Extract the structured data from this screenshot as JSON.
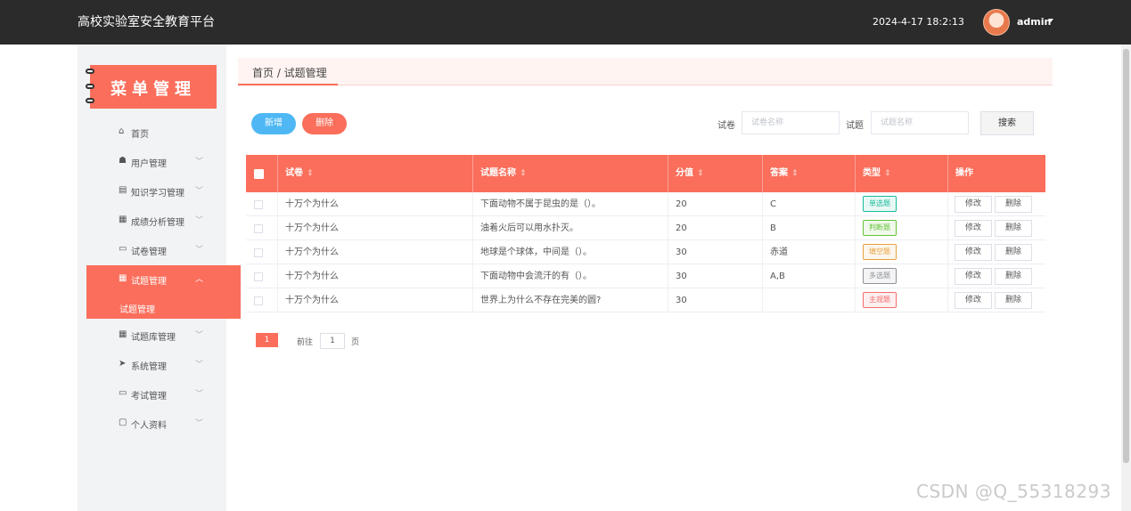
{
  "header": {
    "app_title": "高校实验室安全教育平台",
    "datetime": "2024-4-17 18:2:13",
    "username": "admin"
  },
  "sidebar": {
    "banner_title": "菜单管理",
    "items": [
      {
        "label": "首页",
        "icon": "home-icon"
      },
      {
        "label": "用户管理",
        "icon": "user-icon"
      },
      {
        "label": "知识学习管理",
        "icon": "book-icon"
      },
      {
        "label": "成绩分析管理",
        "icon": "grid-icon"
      },
      {
        "label": "试卷管理",
        "icon": "monitor-icon"
      },
      {
        "label": "试题管理",
        "icon": "grid-icon",
        "active": true
      },
      {
        "label": "试题库管理",
        "icon": "grid-icon"
      },
      {
        "label": "系统管理",
        "icon": "send-icon"
      },
      {
        "label": "考试管理",
        "icon": "monitor-icon"
      },
      {
        "label": "个人资料",
        "icon": "card-icon"
      }
    ],
    "active_sub_label": "试题管理"
  },
  "breadcrumb": "首页 / 试题管理",
  "toolbar": {
    "add_label": "新增",
    "delete_label": "删除",
    "paper_label": "试卷",
    "paper_placeholder": "试卷名称",
    "question_label": "试题",
    "question_placeholder": "试题名称",
    "search_label": "搜索"
  },
  "table": {
    "headers": [
      "试卷",
      "试题名称",
      "分值",
      "答案",
      "类型",
      "操作"
    ],
    "edit_label": "修改",
    "delete_label": "删除",
    "rows": [
      {
        "paper": "十万个为什么",
        "question": "下面动物不属于昆虫的是（）。",
        "score": "20",
        "answer": "C",
        "type": "单选题",
        "type_color": "#1abc9c",
        "type_bg": "#e8f8f4"
      },
      {
        "paper": "十万个为什么",
        "question": "油着火后可以用水扑灭。",
        "score": "20",
        "answer": "B",
        "type": "判断题",
        "type_color": "#67c23a",
        "type_bg": "#f0f9eb"
      },
      {
        "paper": "十万个为什么",
        "question": "地球是个球体，中间是（）。",
        "score": "30",
        "answer": "赤道",
        "type": "填空题",
        "type_color": "#e6a23c",
        "type_bg": "#fdf6ec"
      },
      {
        "paper": "十万个为什么",
        "question": "下面动物中会流汗的有（）。",
        "score": "30",
        "answer": "A,B",
        "type": "多选题",
        "type_color": "#909399",
        "type_bg": "#f4f4f5"
      },
      {
        "paper": "十万个为什么",
        "question": "世界上为什么不存在完美的圆?",
        "score": "30",
        "answer": "",
        "type": "主观题",
        "type_color": "#f56c6c",
        "type_bg": "#fef0f0"
      }
    ]
  },
  "pagination": {
    "current_page": "1",
    "goto_label": "前往",
    "goto_value": "1",
    "page_suffix": "页"
  },
  "watermark": "CSDN @Q_55318293",
  "colors": {
    "accent": "#fa6e5b",
    "topbar": "#2b2b2b",
    "add_button": "#4fb8f4"
  }
}
